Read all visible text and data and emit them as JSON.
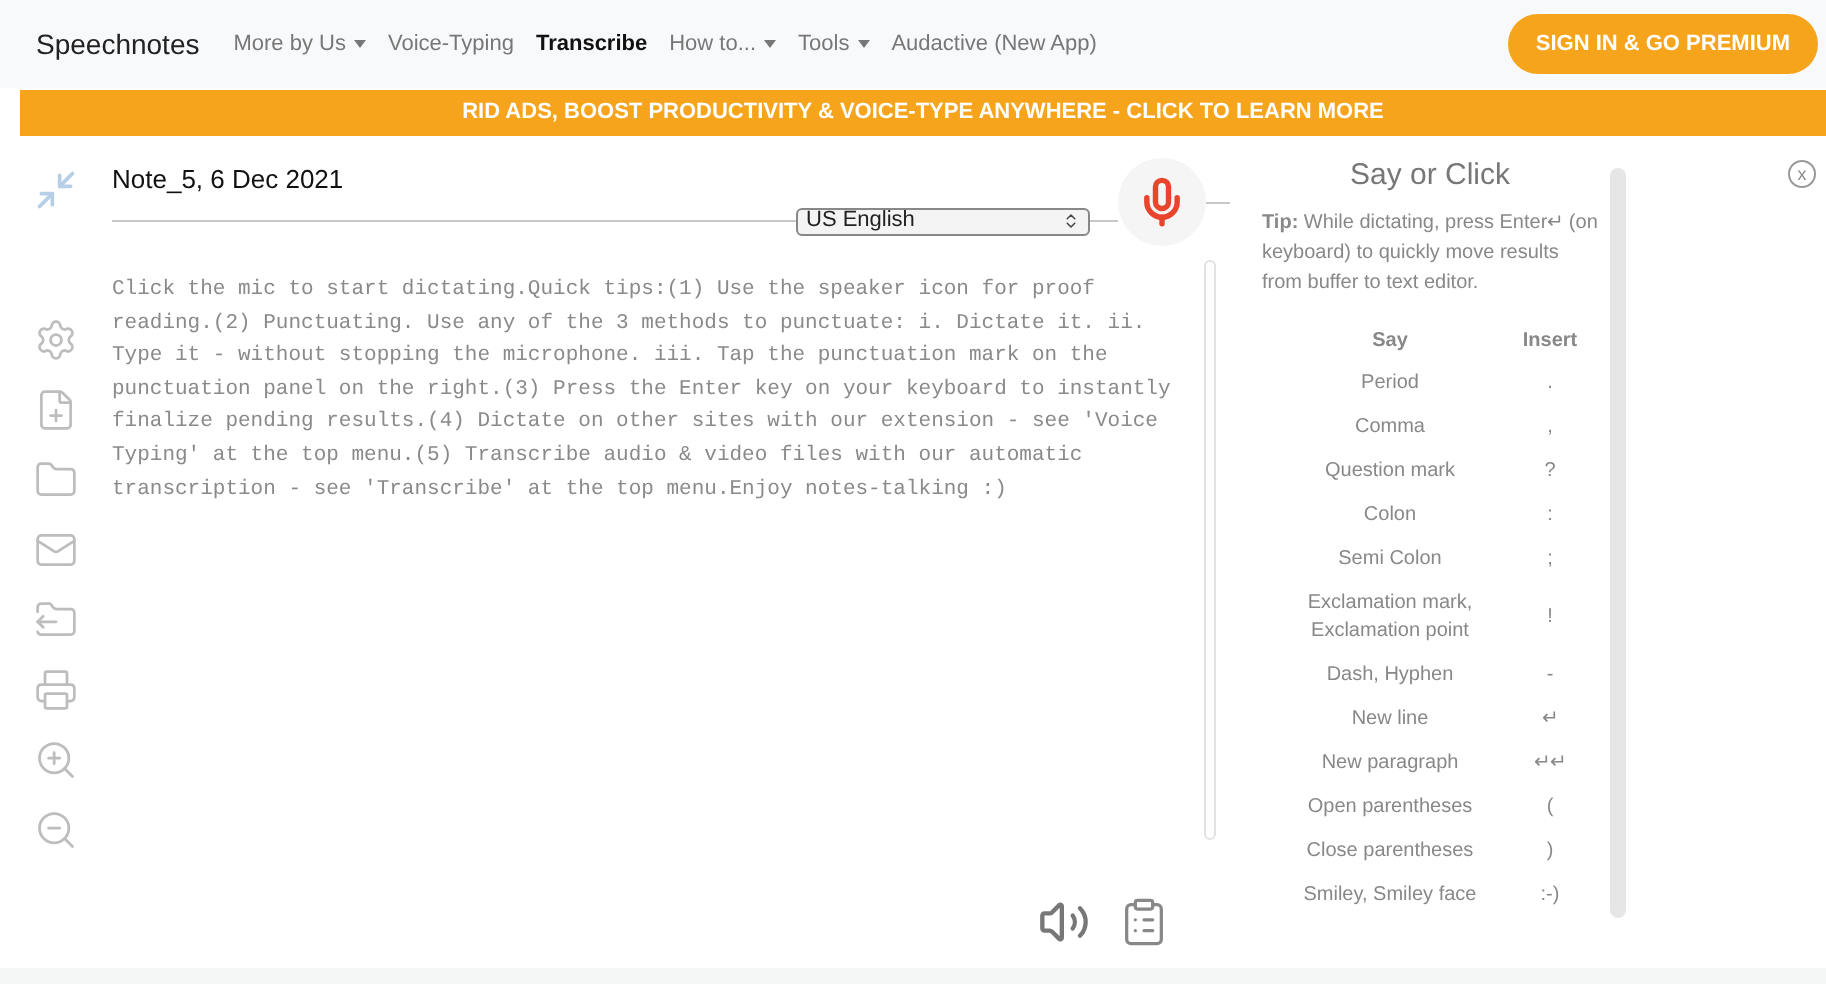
{
  "nav": {
    "brand": "Speechnotes",
    "items": [
      {
        "label": "More by Us",
        "has_menu": true,
        "selected": false
      },
      {
        "label": "Voice-Typing",
        "has_menu": false,
        "selected": false
      },
      {
        "label": "Transcribe",
        "has_menu": false,
        "selected": true
      },
      {
        "label": "How to...",
        "has_menu": true,
        "selected": false
      },
      {
        "label": "Tools",
        "has_menu": true,
        "selected": false
      },
      {
        "label": "Audactive (New App)",
        "has_menu": false,
        "selected": false
      }
    ],
    "premium_button": "SIGN IN & GO PREMIUM"
  },
  "banner": "RID ADS, BOOST PRODUCTIVITY & VOICE-TYPE ANYWHERE - CLICK TO LEARN MORE",
  "editor": {
    "title": "Note_5, 6 Dec 2021",
    "language": "US English",
    "text": "Click the mic to start dictating.Quick tips:(1) Use the speaker icon for proof reading.(2) Punctuating. Use any of the 3 methods to punctuate: i. Dictate it. ii. Type it - without stopping the microphone. iii. Tap the punctuation mark on the punctuation panel on the right.(3) Press the Enter key on your keyboard to instantly finalize pending results.(4) Dictate on other sites with our extension - see 'Voice Typing' at the top menu.(5) Transcribe audio & video files with our automatic transcription - see 'Transcribe' at the top menu.Enjoy notes-talking :)"
  },
  "panel": {
    "title": "Say or Click",
    "close": "x",
    "tip": "**Tip:** While dictating, press Enter↵ (on keyboard) to quickly move results from buffer to text editor.",
    "columns": [
      "Say",
      "Insert"
    ],
    "rows": [
      {
        "say": "Period",
        "insert": "."
      },
      {
        "say": "Comma",
        "insert": ","
      },
      {
        "say": "Question mark",
        "insert": "?"
      },
      {
        "say": "Colon",
        "insert": ":"
      },
      {
        "say": "Semi Colon",
        "insert": ";"
      },
      {
        "say": "Exclamation mark, Exclamation point",
        "insert": "!"
      },
      {
        "say": "Dash, Hyphen",
        "insert": "-"
      },
      {
        "say": "New line",
        "insert": "↵"
      },
      {
        "say": "New paragraph",
        "insert": "↵↵"
      },
      {
        "say": "Open parentheses",
        "insert": "("
      },
      {
        "say": "Close parentheses",
        "insert": ")"
      },
      {
        "say": "Smiley, Smiley face",
        "insert": ":-)"
      }
    ]
  }
}
